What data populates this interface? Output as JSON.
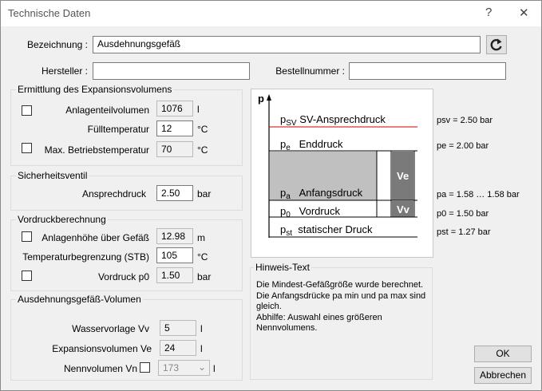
{
  "window": {
    "title": "Technische Daten",
    "help": "?",
    "close": "✕"
  },
  "top": {
    "bezeichnung_label": "Bezeichnung :",
    "bezeichnung_value": "Ausdehnungsgefäß",
    "hersteller_label": "Hersteller :",
    "hersteller_value": "",
    "bestellnummer_label": "Bestellnummer :",
    "bestellnummer_value": ""
  },
  "expansion": {
    "title": "Ermittlung des Expansionsvolumens",
    "anlagenteil_label": "Anlagenteilvolumen",
    "anlagenteil_value": "1076",
    "anlagenteil_unit": "l",
    "fuelltemp_label": "Fülltemperatur",
    "fuelltemp_value": "12",
    "fuelltemp_unit": "°C",
    "maxtemp_label": "Max. Betriebstemperatur",
    "maxtemp_value": "70",
    "maxtemp_unit": "°C"
  },
  "safety": {
    "title": "Sicherheitsventil",
    "ansprech_label": "Ansprechdruck",
    "ansprech_value": "2.50",
    "ansprech_unit": "bar"
  },
  "pre": {
    "title": "Vordruckberechnung",
    "hoehe_label": "Anlagenhöhe über Gefäß",
    "hoehe_value": "12.98",
    "hoehe_unit": "m",
    "stb_label": "Temperaturbegrenzung (STB)",
    "stb_value": "105",
    "stb_unit": "°C",
    "vordruck_label": "Vordruck p0",
    "vordruck_value": "1.50",
    "vordruck_unit": "bar"
  },
  "volume": {
    "title": "Ausdehnungsgefäß-Volumen",
    "wasser_label": "Wasservorlage Vv",
    "wasser_value": "5",
    "wasser_unit": "l",
    "exp_label": "Expansionsvolumen Ve",
    "exp_value": "24",
    "exp_unit": "l",
    "nenn_label": "Nennvolumen Vn",
    "nenn_value": "173",
    "nenn_unit": "l"
  },
  "diagram": {
    "axis": "p",
    "psv_sym": "p",
    "psv_sub": "SV",
    "psv_text": "SV-Ansprechdruck",
    "pe_sym": "p",
    "pe_sub": "e",
    "pe_text": "Enddruck",
    "pa_sym": "p",
    "pa_sub": "a",
    "pa_text": "Anfangsdruck",
    "p0_sym": "p",
    "p0_sub": "0",
    "p0_text": "Vordruck",
    "pst_sym": "p",
    "pst_sub": "st",
    "pst_text": "statischer Druck",
    "ve": "Ve",
    "vv": "Vv",
    "red_color": "#cc0000",
    "fill_color": "#c0c0c0",
    "dark_color": "#7a7a7a"
  },
  "values": {
    "psv": "psv = 2.50 bar",
    "pe": "pe  = 2.00 bar",
    "pa": "pa  = 1.58 … 1.58 bar",
    "p0": "p0  = 1.50 bar",
    "pst": "pst = 1.27 bar"
  },
  "hint": {
    "title": "Hinweis-Text",
    "line1": "Die Mindest-Gefäßgröße wurde berechnet.",
    "line2": "Die Anfangsdrücke pa min und pa max sind",
    "line3": "gleich.",
    "line4": "Abhilfe: Auswahl eines größeren",
    "line5": "Nennvolumens."
  },
  "buttons": {
    "ok": "OK",
    "cancel": "Abbrechen"
  }
}
